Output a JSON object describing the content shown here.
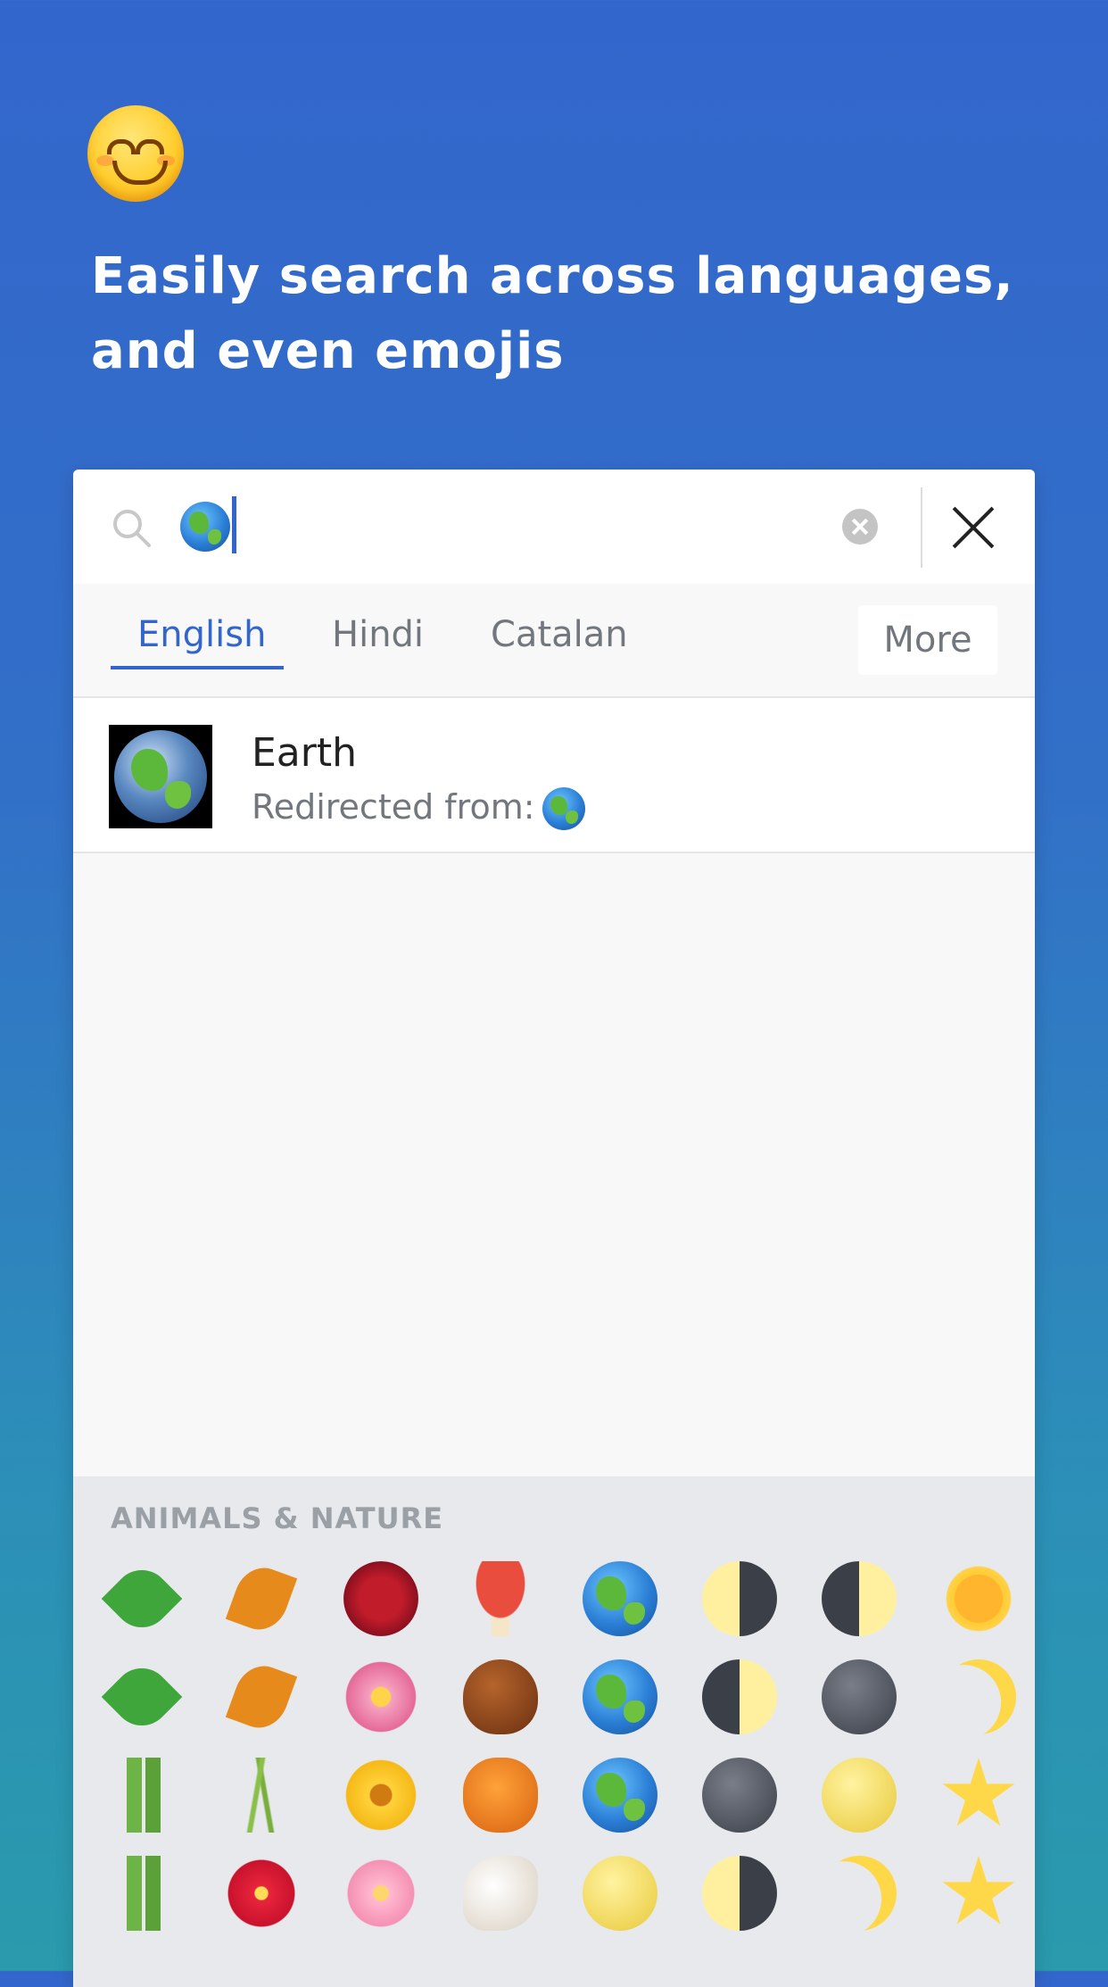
{
  "headline": "Easily search across languages, and even emojis",
  "search": {
    "value": "🌏",
    "placeholder": ""
  },
  "tabs": [
    {
      "label": "English",
      "active": true
    },
    {
      "label": "Hindi",
      "active": false
    },
    {
      "label": "Catalan",
      "active": false
    }
  ],
  "more_label": "More",
  "result": {
    "title": "Earth",
    "subtitle": "Redirected from:",
    "redirect_emoji": "🌏"
  },
  "keyboard": {
    "category": "ANIMALS & NATURE",
    "rows": [
      [
        "shamrock-icon",
        "fallen-leaf-icon",
        "rose-icon",
        "mushroom-icon",
        "earth-americas-icon",
        "first-quarter-moon-icon",
        "waxing-gibbous-moon-icon",
        "sun-with-face-icon"
      ],
      [
        "four-leaf-clover-icon",
        "maple-leaf-icon",
        "tulip-icon",
        "chestnut-icon",
        "earth-africa-icon",
        "waning-crescent-moon-icon",
        "new-moon-face-icon",
        "crescent-moon-icon"
      ],
      [
        "pine-decoration-icon",
        "ear-of-rice-icon",
        "sunflower-icon",
        "jack-o-lantern-icon",
        "earth-asia-icon",
        "new-moon-icon",
        "full-moon-face-icon",
        "star-icon"
      ],
      [
        "tanabata-tree-icon",
        "hibiscus-icon",
        "cherry-blossom-icon",
        "spiral-shell-icon",
        "full-moon-icon",
        "last-quarter-moon-icon",
        "last-quarter-moon-face-icon",
        "glowing-star-icon"
      ]
    ]
  },
  "colors": {
    "accent": "#3366cc",
    "background_top": "#3366cc",
    "background_bottom": "#2a9aac"
  }
}
